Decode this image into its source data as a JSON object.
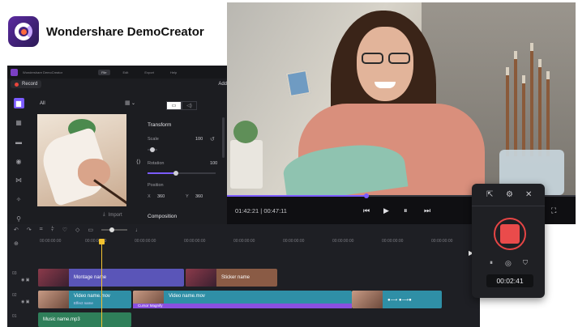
{
  "brand": {
    "name": "Wondershare DemoCreator",
    "logo_icon": "democreator-logo-icon"
  },
  "editor": {
    "app_name": "Wondershare DemoCreator",
    "menu": [
      "File",
      "Edit",
      "Export",
      "Help"
    ],
    "record_label": "Record",
    "add_label": "Add",
    "media_filter": "All",
    "import_label": "Import",
    "rail_icons": [
      "folder-icon",
      "template-icon",
      "caption-icon",
      "sticker-icon",
      "transition-icon",
      "effect-icon",
      "pin-icon"
    ],
    "properties": {
      "transform_title": "Transform",
      "scale_label": "Scale",
      "scale_value": "100",
      "rotation_label": "Rotation",
      "rotation_value": "100",
      "position_label": "Position",
      "pos_x_label": "X",
      "pos_x_value": "360",
      "pos_y_label": "Y",
      "pos_y_value": "360",
      "composition_title": "Composition"
    },
    "timeline": {
      "ruler_labels": [
        "00:00:00:00",
        "00:00:00:00",
        "00:00:00:00",
        "00:00:00:00",
        "00:00:00:00",
        "00:00:00:00",
        "00:00:00:00",
        "00:00:00:00",
        "00:00:00:00"
      ],
      "track_numbers": [
        "03",
        "02",
        "01"
      ],
      "clips": {
        "montage": "Montage name",
        "sticker": "Sticker name",
        "video1": "Video name.mov",
        "video1_effect": "Effect name",
        "video2": "Video name.mov",
        "cursor": "Cursor Magnify",
        "music": "Music name.mp3"
      }
    }
  },
  "preview": {
    "current_time": "01:42:21",
    "total_time": "00:47:11",
    "progress_fraction": 0.4
  },
  "recorder": {
    "timer": "00:02:41",
    "accent_color": "#ea4b4b"
  }
}
